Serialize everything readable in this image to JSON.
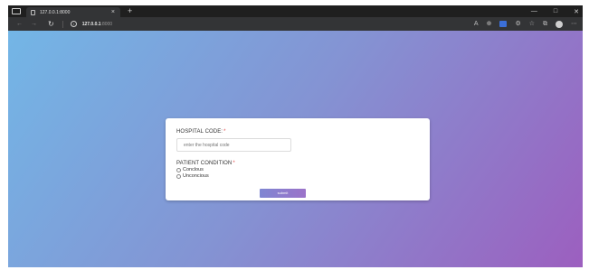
{
  "browser": {
    "tab_title": "127.0.0.1:8000",
    "tab_close": "×",
    "new_tab": "+",
    "url_host": "127.0.0.1",
    "url_port": ":8000",
    "window_controls": [
      "—",
      "□",
      "✕"
    ],
    "toolbar_icons": [
      "read-aloud-icon",
      "zoom-icon",
      "copilot-icon",
      "extensions-icon",
      "favorites-icon",
      "collections-icon",
      "profile-icon",
      "more-icon"
    ]
  },
  "form": {
    "hospital_code_label": "HOSPITAL CODE:",
    "required_marker": "*",
    "hospital_code_placeholder": "enter the hospital code",
    "patient_condition_label": "PATIENT CONDITION",
    "options": [
      "Conclous",
      "Unconcious"
    ],
    "submit_label": "submit"
  },
  "colors": {
    "gradient_start": "#73b6e6",
    "gradient_end": "#9c5fbf",
    "required": "#e24b4b",
    "button": "#8a7ccd"
  }
}
